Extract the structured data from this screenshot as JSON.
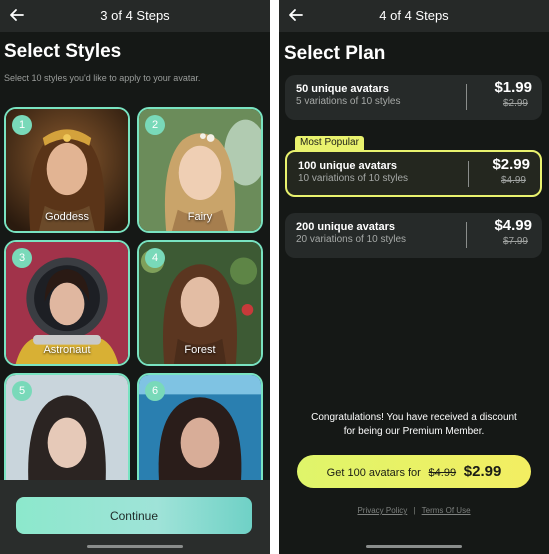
{
  "left": {
    "step": "3 of 4 Steps",
    "heading": "Select Styles",
    "subtext": "Select 10 styles you'd like to apply to your avatar.",
    "tiles": [
      {
        "num": "1",
        "label": "Goddess"
      },
      {
        "num": "2",
        "label": "Fairy"
      },
      {
        "num": "3",
        "label": "Astronaut"
      },
      {
        "num": "4",
        "label": "Forest"
      },
      {
        "num": "5",
        "label": ""
      },
      {
        "num": "6",
        "label": ""
      }
    ],
    "continue_label": "Continue"
  },
  "right": {
    "step": "4 of 4 Steps",
    "heading": "Select Plan",
    "popular_badge": "Most Popular",
    "plans": [
      {
        "title": "50 unique avatars",
        "subtitle": "5 variations of 10 styles",
        "price": "$1.99",
        "old_price": "$2.99",
        "selected": false
      },
      {
        "title": "100 unique avatars",
        "subtitle": "10 variations of 10 styles",
        "price": "$2.99",
        "old_price": "$4.99",
        "selected": true
      },
      {
        "title": "200 unique avatars",
        "subtitle": "20 variations of 10 styles",
        "price": "$4.99",
        "old_price": "$7.99",
        "selected": false
      }
    ],
    "congrats_line1": "Congratulations! You have received a discount",
    "congrats_line2": "for being our Premium Member.",
    "cta": {
      "label": "Get 100 avatars for",
      "old_price": "$4.99",
      "price": "$2.99"
    },
    "footer": {
      "privacy": "Privacy Policy",
      "separator": "|",
      "terms": "Terms Of Use"
    }
  },
  "colors": {
    "background": "#151816",
    "topbar": "#262928",
    "tile_border": "#79e3c1",
    "accent_yellow": "#e9f26e",
    "continue_gradient": "#8ce8cc"
  },
  "icons": {
    "back": "arrow-left-icon"
  }
}
